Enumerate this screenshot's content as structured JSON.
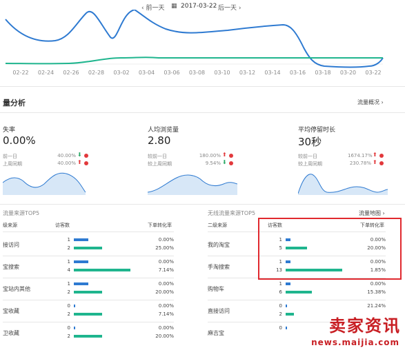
{
  "nav": {
    "prev": "‹ 前一天",
    "date": "2017-03-22",
    "next": "后一天 ›"
  },
  "chart": {
    "x_labels": [
      "02-22",
      "02-24",
      "02-26",
      "02-28",
      "03-02",
      "03-04",
      "03-06",
      "03-08",
      "03-10",
      "03-12",
      "03-14",
      "03-16",
      "03-18",
      "03-20",
      "03-22"
    ],
    "colors": {
      "blue": "#2e7ad1",
      "green": "#1fb58e"
    }
  },
  "section": {
    "title": "量分析",
    "link": "流量概况 ›"
  },
  "kpis": [
    {
      "label": "失率",
      "value": "0.00%",
      "row1_label": "前一日",
      "row1_pct": "40.00%",
      "row1_dir": "down",
      "row2_label": "上周同期",
      "row2_pct": "40.00%",
      "row2_dir": "up"
    },
    {
      "label": "人均浏览量",
      "value": "2.80",
      "row1_label": "较前一日",
      "row1_pct": "180.00%",
      "row1_dir": "up",
      "row2_label": "较上周同期",
      "row2_pct": "9.54%",
      "row2_dir": "down"
    },
    {
      "label": "平均停留时长",
      "value": "30秒",
      "row1_label": "较前一日",
      "row1_pct": "1674.17%",
      "row1_dir": "up",
      "row2_label": "较上周同期",
      "row2_pct": "230.78%",
      "row2_dir": "up"
    }
  ],
  "left_table": {
    "title": "流量来源TOP5",
    "headers": {
      "source": "级来源",
      "visitors": "访客数",
      "rate": "下单转化率"
    },
    "rows": [
      {
        "label": "接访问",
        "v1": "1",
        "v2": "2",
        "r1": "0.00%",
        "r2": "25.00%",
        "b1": 0.25,
        "b2": 0.5
      },
      {
        "label": "宝搜索",
        "v1": "1",
        "v2": "4",
        "r1": "0.00%",
        "r2": "7.14%",
        "b1": 0.25,
        "b2": 1.0
      },
      {
        "label": "宝站内其他",
        "v1": "1",
        "v2": "2",
        "r1": "0.00%",
        "r2": "20.00%",
        "b1": 0.25,
        "b2": 0.5
      },
      {
        "label": "宝收藏",
        "v1": "0",
        "v2": "2",
        "r1": "0.00%",
        "r2": "7.14%",
        "b1": 0.03,
        "b2": 0.5
      },
      {
        "label": "卫收藏",
        "v1": "0",
        "v2": "2",
        "r1": "0.00%",
        "r2": "20.00%",
        "b1": 0.03,
        "b2": 0.5
      }
    ]
  },
  "right_table": {
    "title": "无线流量来源TOP5",
    "link": "流量地图 ›",
    "headers": {
      "source": "二级来源",
      "visitors": "访客数",
      "rate": "下单转化率"
    },
    "rows": [
      {
        "label": "我的淘宝",
        "v1": "1",
        "v2": "5",
        "r1": "0.00%",
        "r2": "20.00%",
        "b1": 0.08,
        "b2": 0.38
      },
      {
        "label": "手淘搜索",
        "v1": "1",
        "v2": "13",
        "r1": "0.00%",
        "r2": "1.85%",
        "b1": 0.08,
        "b2": 1.0
      },
      {
        "label": "购物车",
        "v1": "1",
        "v2": "6",
        "r1": "0.00%",
        "r2": "15.38%",
        "b1": 0.08,
        "b2": 0.46
      },
      {
        "label": "直接访问",
        "v1": "0",
        "v2": "2",
        "r1": "21.24%",
        "r2": "",
        "b1": 0.02,
        "b2": 0.15
      },
      {
        "label": "麻吉宝",
        "v1": "0",
        "v2": "",
        "r1": "",
        "r2": "",
        "b1": 0.0,
        "b2": 0.0
      }
    ]
  },
  "watermark": {
    "line1": "卖家资讯",
    "line2": "news.maijia.com"
  }
}
